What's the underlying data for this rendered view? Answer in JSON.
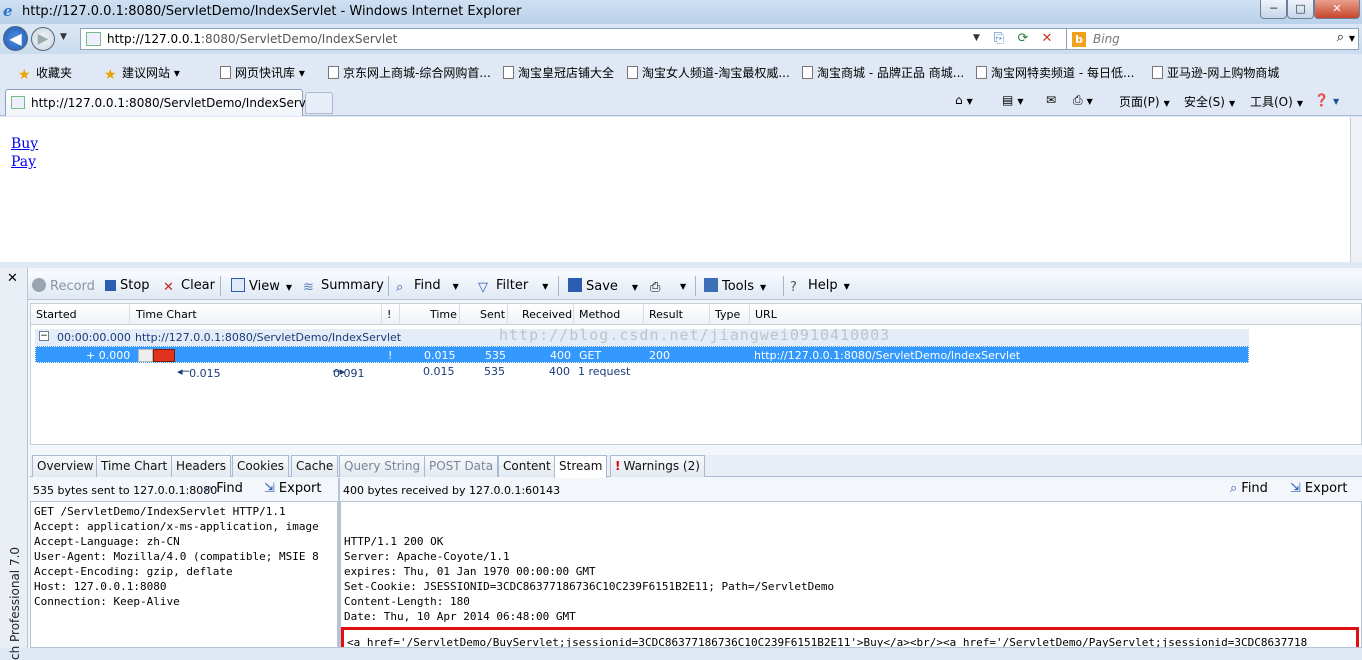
{
  "window": {
    "title": "http://127.0.0.1:8080/ServletDemo/IndexServlet - Windows Internet Explorer",
    "min": "─",
    "max": "□",
    "close": "✕"
  },
  "address": {
    "url_host": "http://127.0.0.1",
    "url_rest": ":8080/ServletDemo/IndexServlet",
    "search_placeholder": "Bing"
  },
  "favorites": {
    "label": "收藏夹",
    "items": [
      "建议网站",
      "网页快讯库",
      "京东网上商城-综合网购首...",
      "淘宝皇冠店铺大全",
      "淘宝女人频道-淘宝最权威...",
      "淘宝商城 - 品牌正品 商城...",
      "淘宝网特卖频道 - 每日低...",
      "亚马逊-网上购物商城"
    ]
  },
  "tab": {
    "title": "http://127.0.0.1:8080/ServletDemo/IndexServ..."
  },
  "commands": {
    "page": "页面(P)",
    "safety": "安全(S)",
    "tools": "工具(O)"
  },
  "page": {
    "links": [
      "Buy",
      "Pay"
    ]
  },
  "fiddler": {
    "side_label": "ch Professional 7.0",
    "toolbar": {
      "record": "Record",
      "stop": "Stop",
      "clear": "Clear",
      "view": "View",
      "summary": "Summary",
      "find": "Find",
      "filter": "Filter",
      "save": "Save",
      "tools": "Tools",
      "help": "Help"
    },
    "columns": [
      "Started",
      "Time Chart",
      "!",
      "Time",
      "Sent",
      "Received",
      "Method",
      "Result",
      "Type",
      "URL"
    ],
    "rows": [
      {
        "started": "00:00:00.000",
        "url": "http://127.0.0.1:8080/ServletDemo/IndexServlet"
      },
      {
        "started": "+ 0.000",
        "flag": "!",
        "time": "0.015",
        "sent": "535",
        "received": "400",
        "method": "GET",
        "result": "200",
        "url": "http://127.0.0.1:8080/ServletDemo/IndexServlet"
      },
      {
        "start_marker": "0.015",
        "end_marker": "0.091",
        "time": "0.015",
        "sent": "535",
        "received": "400",
        "method": "1 request"
      }
    ],
    "watermark": "http://blog.csdn.net/jiangwei0910410003",
    "inspector_tabs": [
      "Overview",
      "Time Chart",
      "Headers",
      "Cookies",
      "Cache",
      "Query String",
      "POST Data",
      "Content",
      "Stream",
      "Warnings (2)"
    ],
    "request_info": "535 bytes sent to 127.0.0.1:8080",
    "response_info": "400 bytes received by 127.0.0.1:60143",
    "find": "Find",
    "export": "Export",
    "request_text": "GET /ServletDemo/IndexServlet HTTP/1.1\nAccept: application/x-ms-application, image\nAccept-Language: zh-CN\nUser-Agent: Mozilla/4.0 (compatible; MSIE 8\nAccept-Encoding: gzip, deflate\nHost: 127.0.0.1:8080\nConnection: Keep-Alive",
    "response_text": "HTTP/1.1 200 OK\nServer: Apache-Coyote/1.1\nexpires: Thu, 01 Jan 1970 00:00:00 GMT\nSet-Cookie: JSESSIONID=3CDC86377186736C10C239F6151B2E11; Path=/ServletDemo\nContent-Length: 180\nDate: Thu, 10 Apr 2014 06:48:00 GMT",
    "response_body": "<a href='/ServletDemo/BuyServlet;jsessionid=3CDC86377186736C10C239F6151B2E11'>Buy</a><br/><a href='/ServletDemo/PayServlet;jsessionid=3CDC8637718"
  },
  "colors": {
    "selected_row": "#3399ff",
    "highlight_box": "#e01010",
    "link": "#0000ee"
  }
}
